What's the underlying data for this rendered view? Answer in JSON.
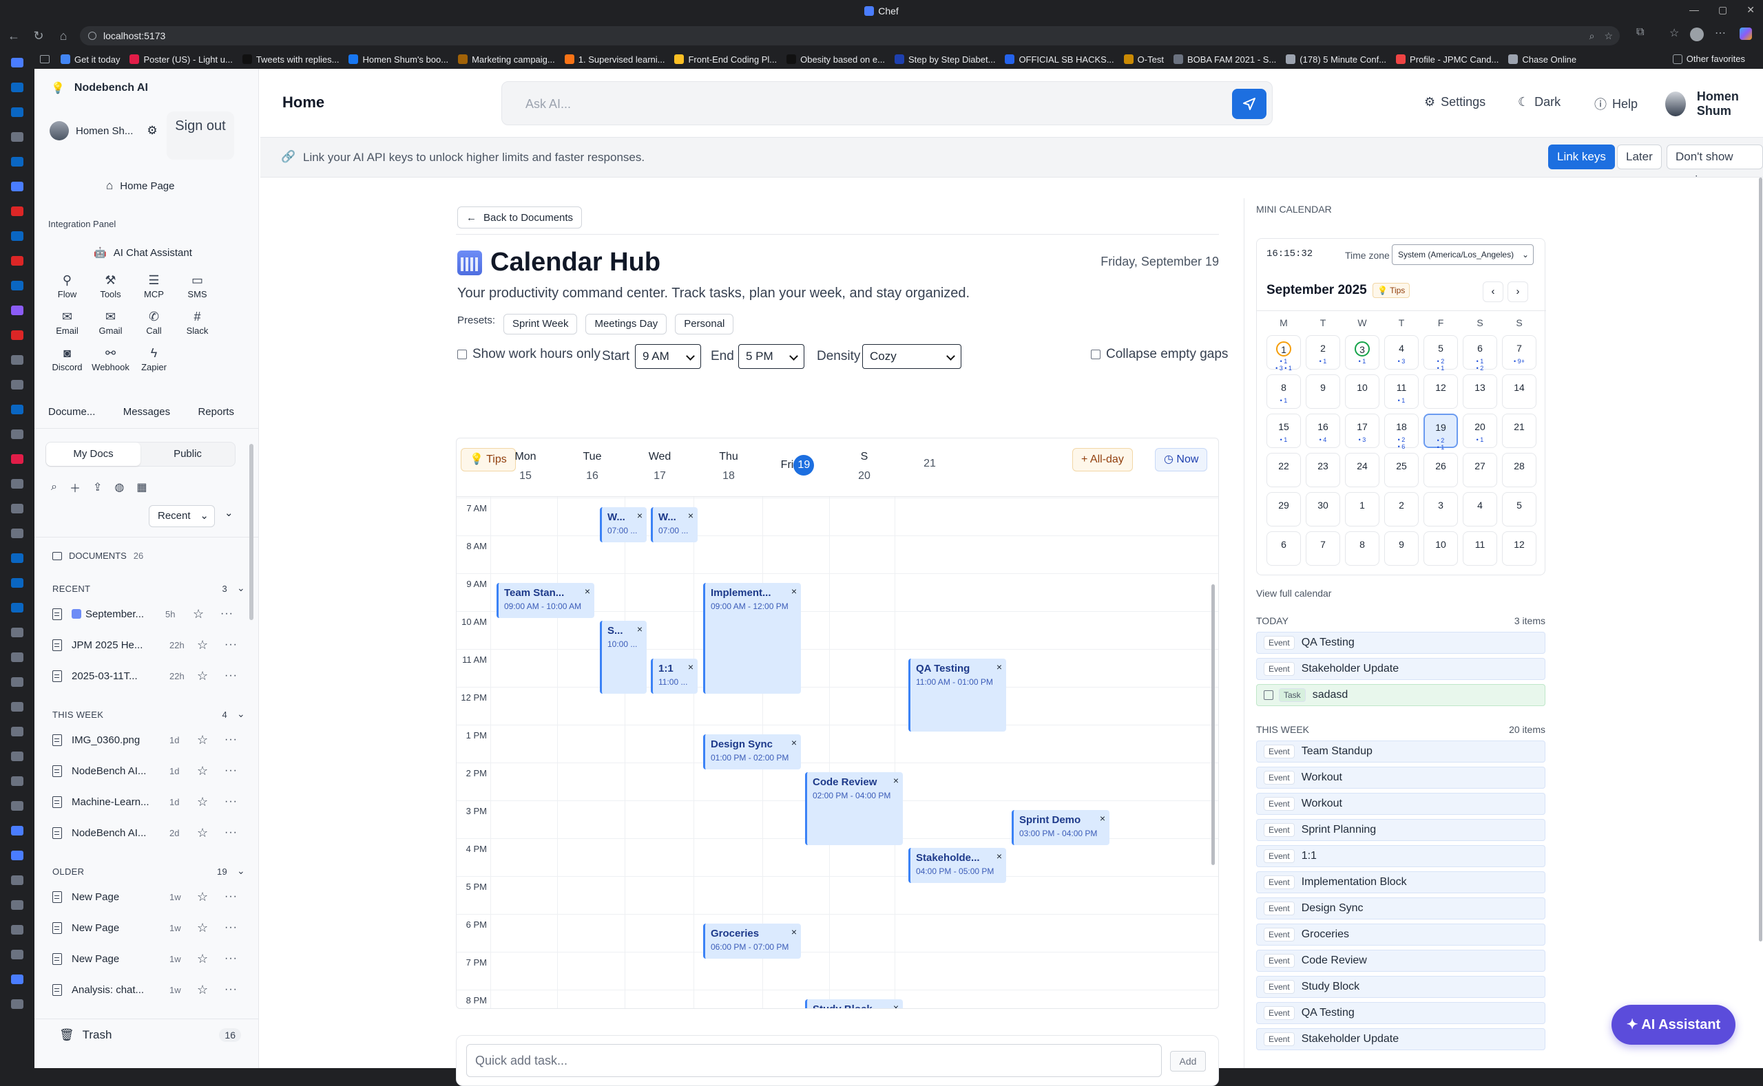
{
  "browser": {
    "window_title": "Chef",
    "url": "localhost:5173",
    "bookmarks": [
      "Get it today",
      "Poster (US) - Light u...",
      "Tweets with replies...",
      "Homen Shum's boo...",
      "Marketing campaig...",
      "1. Supervised learni...",
      "Front-End Coding Pl...",
      "Obesity based on e...",
      "Step by Step Diabet...",
      "OFFICIAL SB HACKS...",
      "O-Test",
      "BOBA FAM 2021 - S...",
      "(178) 5 Minute Conf...",
      "Profile - JPMC Cand...",
      "Chase Online"
    ],
    "other_bookmarks": "Other favorites"
  },
  "sidebar": {
    "app_name": "Nodebench AI",
    "user_short": "Homen Sh...",
    "sign_out": "Sign out",
    "home_page": "Home Page",
    "integration_panel": "Integration Panel",
    "ai_chat": "AI Chat Assistant",
    "integrations": [
      {
        "label": "Flow",
        "icon": "flow-icon"
      },
      {
        "label": "Tools",
        "icon": "tools-icon"
      },
      {
        "label": "MCP",
        "icon": "mcp-icon"
      },
      {
        "label": "SMS",
        "icon": "sms-icon"
      },
      {
        "label": "Email",
        "icon": "email-icon"
      },
      {
        "label": "Gmail",
        "icon": "gmail-icon"
      },
      {
        "label": "Call",
        "icon": "call-icon"
      },
      {
        "label": "Slack",
        "icon": "slack-icon"
      },
      {
        "label": "Discord",
        "icon": "discord-icon"
      },
      {
        "label": "Webhook",
        "icon": "webhook-icon"
      },
      {
        "label": "Zapier",
        "icon": "zapier-icon"
      }
    ],
    "tabs": [
      "Docume...",
      "Messages",
      "Reports"
    ],
    "scope": [
      "My Docs",
      "Public"
    ],
    "sort": "Recent",
    "documents_label": "DOCUMENTS",
    "documents_count": "26",
    "sections": [
      {
        "title": "RECENT",
        "count": "3",
        "docs": [
          {
            "name": "September...",
            "age": "5h",
            "cal": true
          },
          {
            "name": "JPM 2025 He...",
            "age": "22h"
          },
          {
            "name": "2025-03-11T...",
            "age": "22h"
          }
        ]
      },
      {
        "title": "THIS WEEK",
        "count": "4",
        "docs": [
          {
            "name": "IMG_0360.png",
            "age": "1d"
          },
          {
            "name": "NodeBench AI...",
            "age": "1d"
          },
          {
            "name": "Machine-Learn...",
            "age": "1d"
          },
          {
            "name": "NodeBench AI...",
            "age": "2d"
          }
        ]
      },
      {
        "title": "OLDER",
        "count": "19",
        "docs": [
          {
            "name": "New Page",
            "age": "1w"
          },
          {
            "name": "New Page",
            "age": "1w"
          },
          {
            "name": "New Page",
            "age": "1w"
          },
          {
            "name": "Analysis: chat...",
            "age": "1w"
          }
        ]
      }
    ],
    "trash": "Trash",
    "trash_count": "16"
  },
  "header": {
    "title": "Home",
    "ask_placeholder": "Ask AI...",
    "settings": "Settings",
    "dark": "Dark",
    "help": "Help",
    "user": "Homen Shum"
  },
  "banner": {
    "text": "Link your AI API keys to unlock higher limits and faster responses.",
    "link_keys": "Link keys",
    "later": "Later",
    "dont_show": "Don't show again"
  },
  "calendar": {
    "back": "Back to Documents",
    "title": "Calendar Hub",
    "date": "Friday, September 19",
    "subtitle": "Your productivity command center. Track tasks, plan your week, and stay organized.",
    "presets_label": "Presets:",
    "presets": [
      "Sprint Week",
      "Meetings Day",
      "Personal"
    ],
    "show_work_hours": "Show work hours only",
    "start_label": "Start",
    "start": "9 AM",
    "end_label": "End",
    "end": "5 PM",
    "density_label": "Density",
    "density": "Cozy",
    "collapse": "Collapse empty gaps",
    "tips": "Tips",
    "allday": "All-day",
    "now": "Now",
    "days": [
      {
        "d": "Mon",
        "n": "15"
      },
      {
        "d": "Tue",
        "n": "16"
      },
      {
        "d": "Wed",
        "n": "17"
      },
      {
        "d": "Thu",
        "n": "18"
      },
      {
        "d": "Fri",
        "n": "19",
        "today": true
      },
      {
        "d": "S",
        "n": "20"
      },
      {
        "d": "",
        "n": "21"
      }
    ],
    "times": [
      "7 AM",
      "8 AM",
      "9 AM",
      "10 AM",
      "11 AM",
      "12 PM",
      "1 PM",
      "2 PM",
      "3 PM",
      "4 PM",
      "5 PM",
      "6 PM",
      "7 PM",
      "8 PM"
    ],
    "events": [
      {
        "title": "W...",
        "time": "07:00 ...",
        "day": 1,
        "sub": 0,
        "start": 7,
        "end": 8
      },
      {
        "title": "W...",
        "time": "07:00 ...",
        "day": 1,
        "sub": 1,
        "start": 7,
        "end": 8
      },
      {
        "title": "Team Stan...",
        "time": "09:00 AM - 10:00 AM",
        "day": 0,
        "start": 9,
        "end": 10
      },
      {
        "title": "S...",
        "time": "10:00 ...",
        "day": 1,
        "sub": 0,
        "start": 10,
        "end": 12
      },
      {
        "title": "1:1",
        "time": "11:00 ...",
        "day": 1,
        "sub": 1,
        "start": 11,
        "end": 12
      },
      {
        "title": "Implement...",
        "time": "09:00 AM - 12:00 PM",
        "day": 2,
        "start": 9,
        "end": 12
      },
      {
        "title": "QA Testing",
        "time": "11:00 AM - 01:00 PM",
        "day": 4,
        "start": 11,
        "end": 13
      },
      {
        "title": "Design Sync",
        "time": "01:00 PM - 02:00 PM",
        "day": 2,
        "start": 13,
        "end": 14
      },
      {
        "title": "Code Review",
        "time": "02:00 PM - 04:00 PM",
        "day": 3,
        "start": 14,
        "end": 16
      },
      {
        "title": "Sprint Demo",
        "time": "03:00 PM - 04:00 PM",
        "day": 5,
        "start": 15,
        "end": 16
      },
      {
        "title": "Stakeholde...",
        "time": "04:00 PM - 05:00 PM",
        "day": 4,
        "start": 16,
        "end": 17
      },
      {
        "title": "Groceries",
        "time": "06:00 PM - 07:00 PM",
        "day": 2,
        "start": 18,
        "end": 19
      },
      {
        "title": "Study Block",
        "time": "",
        "day": 3,
        "start": 20,
        "end": 21
      }
    ],
    "quick_add_placeholder": "Quick add task...",
    "add": "Add"
  },
  "mini": {
    "label": "MINI CALENDAR",
    "clock": "16:15:32",
    "tz_label": "Time zone",
    "tz": "System (America/Los_Angeles)",
    "month": "September 2025",
    "tips": "Tips",
    "dow": [
      "M",
      "T",
      "W",
      "T",
      "F",
      "S",
      "S"
    ],
    "cells": [
      {
        "n": "1",
        "dots": "• 1\n• 3 • 1",
        "ring": "yellow"
      },
      {
        "n": "2",
        "dots": "• 1"
      },
      {
        "n": "3",
        "dots": "• 1",
        "ring": "green"
      },
      {
        "n": "4",
        "dots": "• 3"
      },
      {
        "n": "5",
        "dots": "• 2\n• 1"
      },
      {
        "n": "6",
        "dots": "• 1\n• 2"
      },
      {
        "n": "7",
        "dots": "• 9+"
      },
      {
        "n": "8",
        "dots": "• 1"
      },
      {
        "n": "9"
      },
      {
        "n": "10"
      },
      {
        "n": "11",
        "dots": "• 1"
      },
      {
        "n": "12"
      },
      {
        "n": "13"
      },
      {
        "n": "14"
      },
      {
        "n": "15",
        "dots": "• 1"
      },
      {
        "n": "16",
        "dots": "• 4"
      },
      {
        "n": "17",
        "dots": "• 3"
      },
      {
        "n": "18",
        "dots": "• 2\n• 6"
      },
      {
        "n": "19",
        "dots": "• 2\n• 1",
        "sel": true
      },
      {
        "n": "20",
        "dots": "• 1"
      },
      {
        "n": "21"
      },
      {
        "n": "22"
      },
      {
        "n": "23"
      },
      {
        "n": "24"
      },
      {
        "n": "25"
      },
      {
        "n": "26"
      },
      {
        "n": "27"
      },
      {
        "n": "28"
      },
      {
        "n": "29"
      },
      {
        "n": "30"
      },
      {
        "n": "1"
      },
      {
        "n": "2"
      },
      {
        "n": "3"
      },
      {
        "n": "4"
      },
      {
        "n": "5"
      },
      {
        "n": "6"
      },
      {
        "n": "7"
      },
      {
        "n": "8"
      },
      {
        "n": "9"
      },
      {
        "n": "10"
      },
      {
        "n": "11"
      },
      {
        "n": "12"
      }
    ],
    "view_full": "View full calendar",
    "today_label": "TODAY",
    "today_count": "3 items",
    "today_items": [
      {
        "tag": "Event",
        "title": "QA Testing"
      },
      {
        "tag": "Event",
        "title": "Stakeholder Update"
      },
      {
        "tag": "Task",
        "title": "sadasd",
        "task": true
      }
    ],
    "week_label": "THIS WEEK",
    "week_count": "20 items",
    "week_items": [
      "Team Standup",
      "Workout",
      "Workout",
      "Sprint Planning",
      "1:1",
      "Implementation Block",
      "Design Sync",
      "Groceries",
      "Code Review",
      "Study Block",
      "QA Testing",
      "Stakeholder Update"
    ]
  },
  "ai_button": "AI Assistant",
  "colors": {
    "accent": "#1d6fe0",
    "event_bg": "#dbeafe",
    "ai_button": "#5b4cdb",
    "today_task": "#e8f7ec"
  }
}
